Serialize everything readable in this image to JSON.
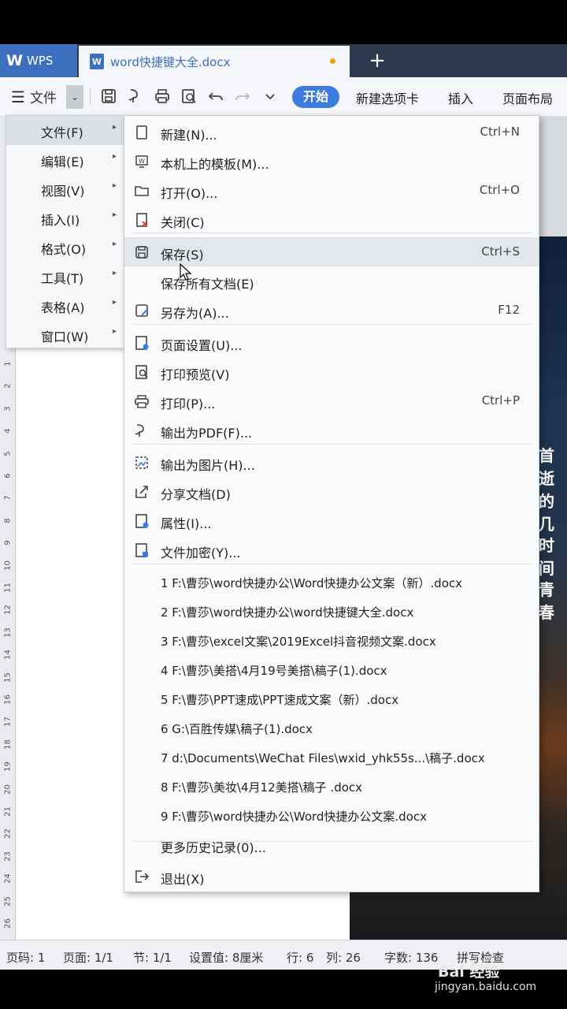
{
  "tabbar": {
    "app_label": "WPS",
    "doc_tab_title": "word快捷键大全.docx",
    "doc_icon": "W",
    "add_tab": "+"
  },
  "toolbar": {
    "menu_label": "文件",
    "start_label": "开始",
    "tabs": [
      "新建选项卡",
      "插入",
      "页面布局"
    ]
  },
  "left_menu": {
    "items": [
      {
        "label": "文件(F)",
        "active": true
      },
      {
        "label": "编辑(E)"
      },
      {
        "label": "视图(V)"
      },
      {
        "label": "插入(I)"
      },
      {
        "label": "格式(O)"
      },
      {
        "label": "工具(T)"
      },
      {
        "label": "表格(A)"
      },
      {
        "label": "窗口(W)"
      }
    ]
  },
  "file_menu": {
    "items": [
      {
        "label": "新建(N)...",
        "shortcut": "Ctrl+N",
        "icon": "new-doc-icon"
      },
      {
        "label": "本机上的模板(M)...",
        "shortcut": "",
        "icon": "template-icon"
      },
      {
        "label": "打开(O)...",
        "shortcut": "Ctrl+O",
        "icon": "folder-icon"
      },
      {
        "label": "关闭(C)",
        "shortcut": "",
        "icon": "close-doc-icon"
      },
      {
        "label": "保存(S)",
        "shortcut": "Ctrl+S",
        "icon": "save-icon"
      },
      {
        "label": "保存所有文档(E)",
        "shortcut": "",
        "icon": ""
      },
      {
        "label": "另存为(A)...",
        "shortcut": "F12",
        "icon": "save-as-icon"
      },
      {
        "label": "页面设置(U)...",
        "shortcut": "",
        "icon": "page-setup-icon"
      },
      {
        "label": "打印预览(V)",
        "shortcut": "",
        "icon": "print-preview-icon"
      },
      {
        "label": "打印(P)...",
        "shortcut": "Ctrl+P",
        "icon": "printer-icon"
      },
      {
        "label": "输出为PDF(F)...",
        "shortcut": "",
        "icon": "pdf-export-icon"
      },
      {
        "label": "输出为图片(H)...",
        "shortcut": "",
        "icon": "image-export-icon"
      },
      {
        "label": "分享文档(D)",
        "shortcut": "",
        "icon": "share-icon"
      },
      {
        "label": "属性(I)...",
        "shortcut": "",
        "icon": "properties-icon"
      },
      {
        "label": "文件加密(Y)...",
        "shortcut": "",
        "icon": "encrypt-icon"
      }
    ],
    "recent": [
      "1 F:\\曹莎\\word快捷办公\\Word快捷办公文案（新）.docx",
      "2 F:\\曹莎\\word快捷办公\\word快捷键大全.docx",
      "3 F:\\曹莎\\excel文案\\2019Excel抖音视频文案.docx",
      "4 F:\\曹莎\\美搭\\4月19号美搭\\稿子(1).docx",
      "5 F:\\曹莎\\PPT速成\\PPT速成文案（新）.docx",
      "6 G:\\百胜传媒\\稿子(1).docx",
      "7 d:\\Documents\\WeChat Files\\wxid_yhk55s...\\稿子.docx",
      "8 F:\\曹莎\\美妆\\4月12美搭\\稿子 .docx",
      "9 F:\\曹莎\\word快捷办公\\Word快捷办公文案.docx"
    ],
    "more_history": "更多历史记录(0)...",
    "exit": "退出(X)"
  },
  "photo_text": [
    "首逝",
    "的几",
    "时间",
    "青春"
  ],
  "status": {
    "page_no": "页码: 1",
    "pages": "页面: 1/1",
    "section": "节: 1/1",
    "setting": "设置值: 8厘米",
    "row": "行: 6",
    "col": "列: 26",
    "words": "字数: 136",
    "spellcheck": "拼写检查"
  },
  "watermark": {
    "brand": "Bai 经验",
    "url": "jingyan.baidu.com"
  },
  "ruler_numbers": [
    "1",
    "2",
    "3",
    "4",
    "5",
    "6",
    "7",
    "8",
    "9",
    "10",
    "11",
    "12",
    "13",
    "14",
    "15",
    "16",
    "17",
    "18",
    "19",
    "20",
    "21",
    "22",
    "23",
    "24",
    "25",
    "26"
  ]
}
